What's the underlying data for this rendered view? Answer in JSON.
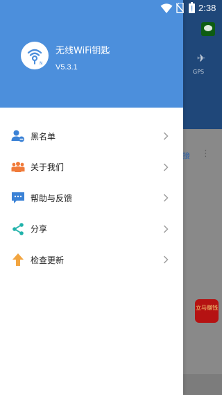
{
  "status_bar": {
    "time": "2:38",
    "icons": [
      "wifi-icon",
      "no-sim-icon",
      "battery-icon"
    ]
  },
  "drawer": {
    "app_name": "无线WiFi钥匙",
    "version": "V5.3.1",
    "header_color": "#4c8fdc",
    "items": [
      {
        "label": "黑名单",
        "icon": "blacklist-user-icon",
        "color": "#3b82d6"
      },
      {
        "label": "关于我们",
        "icon": "people-icon",
        "color": "#f07b3a"
      },
      {
        "label": "帮助与反馈",
        "icon": "chat-bubble-icon",
        "color": "#3b82d6"
      },
      {
        "label": "分享",
        "icon": "share-icon",
        "color": "#20b2aa"
      },
      {
        "label": "检查更新",
        "icon": "update-arrow-icon",
        "color": "#f2a540"
      }
    ]
  },
  "background": {
    "gps_label": "GPS",
    "connect_label": "接",
    "ad_text": "立马赚钱"
  }
}
